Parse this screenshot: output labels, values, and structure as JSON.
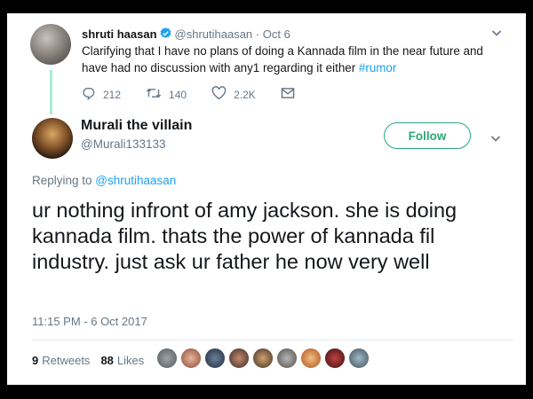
{
  "parent_tweet": {
    "name": "shruti haasan",
    "handle": "@shrutihaasan",
    "date": "· Oct 6",
    "text": "Clarifying that I have no plans of doing a Kannada film in the near future and have had no discussion with any1 regarding it either ",
    "hashtag": "#rumor",
    "replies": "212",
    "retweets": "140",
    "likes": "2.2K"
  },
  "reply_tweet": {
    "name": "Murali the villain",
    "handle": "@Murali133133",
    "follow_label": "Follow",
    "replying_prefix": "Replying to ",
    "replying_to": "@shrutihaasan",
    "text": "ur nothing infront of amy jackson. she is doing kannada film. thats the power of kannada fil industry. just ask ur father he now very well",
    "timestamp": "11:15 PM - 6 Oct 2017",
    "retweet_count": "9",
    "retweet_label": "Retweets",
    "like_count": "88",
    "like_label": "Likes"
  },
  "colors": {
    "accent": "#1da1f2",
    "follow_green": "#2aa876",
    "thread_line": "#a7ecd3",
    "muted": "#657786"
  },
  "icons": [
    "verified-icon",
    "reply-icon",
    "retweet-icon",
    "like-icon",
    "message-icon",
    "chevron-down-icon"
  ]
}
